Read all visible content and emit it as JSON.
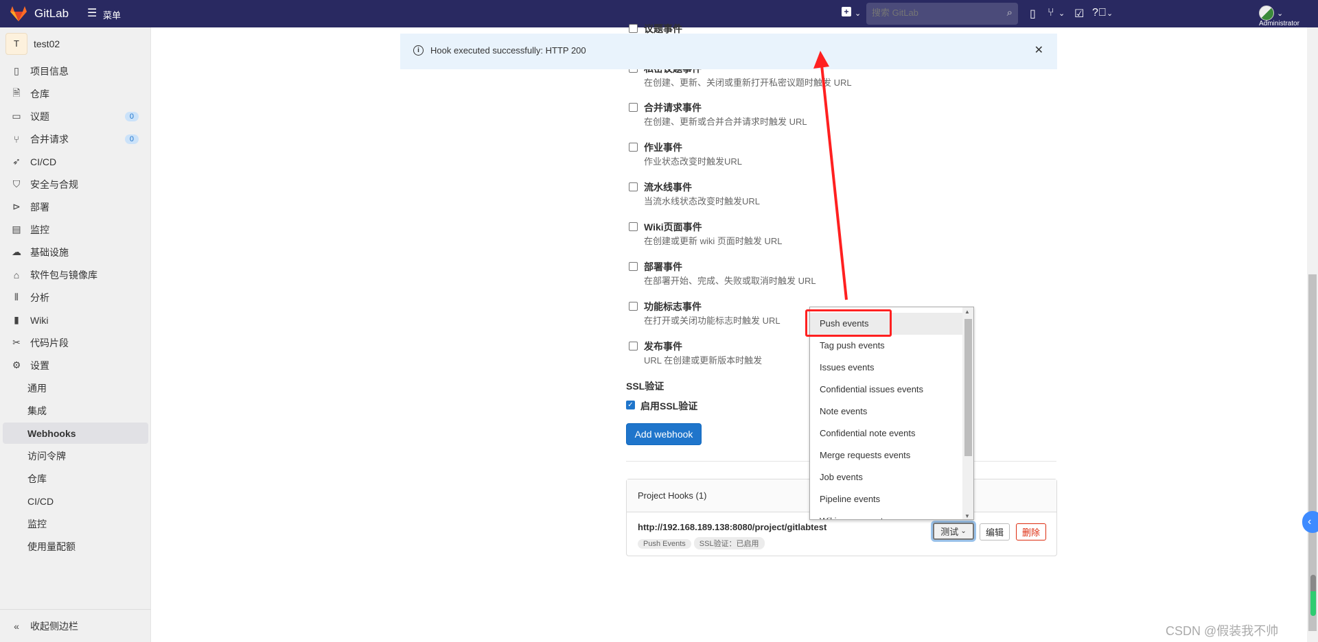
{
  "header": {
    "brand": "GitLab",
    "menu_label": "菜单",
    "search_placeholder": "搜索 GitLab",
    "user_label": "Administrator"
  },
  "sidebar": {
    "project_initial": "T",
    "project_name": "test02",
    "items": [
      {
        "label": "项目信息",
        "icon": "project-icon"
      },
      {
        "label": "仓库",
        "icon": "file-icon"
      },
      {
        "label": "议题",
        "icon": "issues-icon",
        "count": "0"
      },
      {
        "label": "合并请求",
        "icon": "merge-request-icon",
        "count": "0"
      },
      {
        "label": "CI/CD",
        "icon": "rocket-icon"
      },
      {
        "label": "安全与合规",
        "icon": "shield-icon"
      },
      {
        "label": "部署",
        "icon": "deploy-icon"
      },
      {
        "label": "监控",
        "icon": "monitor-icon"
      },
      {
        "label": "基础设施",
        "icon": "infrastructure-icon"
      },
      {
        "label": "软件包与镜像库",
        "icon": "package-icon"
      },
      {
        "label": "分析",
        "icon": "chart-icon"
      },
      {
        "label": "Wiki",
        "icon": "book-icon"
      },
      {
        "label": "代码片段",
        "icon": "snippet-icon"
      },
      {
        "label": "设置",
        "icon": "gear-icon"
      }
    ],
    "settings_sub": [
      "通用",
      "集成",
      "Webhooks",
      "访问令牌",
      "仓库",
      "CI/CD",
      "监控",
      "使用量配额"
    ],
    "active_sub": "Webhooks",
    "collapse_label": "收起侧边栏"
  },
  "alert": {
    "message": "Hook executed successfully: HTTP 200"
  },
  "events": [
    {
      "label": "议题事件",
      "desc": ""
    },
    {
      "label": "私密议题事件",
      "desc": "在创建、更新、关闭或重新打开私密议题时触发 URL"
    },
    {
      "label": "合并请求事件",
      "desc": "在创建、更新或合并合并请求时触发 URL"
    },
    {
      "label": "作业事件",
      "desc": "作业状态改变时触发URL"
    },
    {
      "label": "流水线事件",
      "desc": "当流水线状态改变时触发URL"
    },
    {
      "label": "Wiki页面事件",
      "desc": "在创建或更新 wiki 页面时触发 URL"
    },
    {
      "label": "部署事件",
      "desc": "在部署开始、完成、失败或取消时触发 URL"
    },
    {
      "label": "功能标志事件",
      "desc": "在打开或关闭功能标志时触发 URL"
    },
    {
      "label": "发布事件",
      "desc": "URL 在创建或更新版本时触发"
    }
  ],
  "ssl": {
    "heading": "SSL验证",
    "checkbox_label": "启用SSL验证",
    "checked": true
  },
  "add_webhook_label": "Add webhook",
  "hooks": {
    "title": "Project Hooks (1)",
    "url": "http://192.168.189.138:8080/project/gitlabtest",
    "tags": [
      "Push Events",
      "SSL验证：已启用"
    ],
    "test_label": "测试",
    "edit_label": "编辑",
    "delete_label": "删除"
  },
  "test_dropdown": {
    "selected": "Push events",
    "options": [
      "Push events",
      "Tag push events",
      "Issues events",
      "Confidential issues events",
      "Note events",
      "Confidential note events",
      "Merge requests events",
      "Job events",
      "Pipeline events",
      "Wiki page events"
    ]
  },
  "watermark": "CSDN @假装我不帅",
  "colors": {
    "header": "#292961",
    "primary": "#1f75cb",
    "annotation": "#ff2020",
    "alert_bg": "#e9f3fc"
  }
}
